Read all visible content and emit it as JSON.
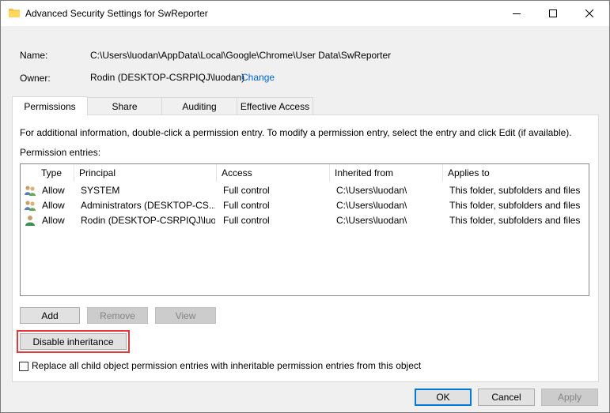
{
  "window": {
    "title": "Advanced Security Settings for SwReporter",
    "controls": [
      "minimize-icon",
      "maximize-icon",
      "close-icon"
    ]
  },
  "info": {
    "name_label": "Name:",
    "name_value": "C:\\Users\\luodan\\AppData\\Local\\Google\\Chrome\\User Data\\SwReporter",
    "owner_label": "Owner:",
    "owner_value": "Rodin (DESKTOP-CSRPIQJ\\luodan)",
    "change_link": "Change"
  },
  "tabs": [
    {
      "label": "Permissions",
      "active": true
    },
    {
      "label": "Share",
      "active": false
    },
    {
      "label": "Auditing",
      "active": false
    },
    {
      "label": "Effective Access",
      "active": false
    }
  ],
  "permissions": {
    "info_text": "For additional information, double-click a permission entry. To modify a permission entry, select the entry and click Edit (if available).",
    "entries_label": "Permission entries:",
    "columns": [
      "Type",
      "Principal",
      "Access",
      "Inherited from",
      "Applies to"
    ],
    "rows": [
      {
        "icon": "group-users-icon",
        "type": "Allow",
        "principal": "SYSTEM",
        "access": "Full control",
        "inherited": "C:\\Users\\luodan\\",
        "applies": "This folder, subfolders and files"
      },
      {
        "icon": "group-users-icon",
        "type": "Allow",
        "principal": "Administrators (DESKTOP-CS...",
        "access": "Full control",
        "inherited": "C:\\Users\\luodan\\",
        "applies": "This folder, subfolders and files"
      },
      {
        "icon": "user-icon",
        "type": "Allow",
        "principal": "Rodin (DESKTOP-CSRPIQJ\\luo...",
        "access": "Full control",
        "inherited": "C:\\Users\\luodan\\",
        "applies": "This folder, subfolders and files"
      }
    ],
    "buttons": {
      "add": "Add",
      "remove": "Remove",
      "view": "View"
    },
    "disable_inheritance": "Disable inheritance",
    "replace_checkbox_label": "Replace all child object permission entries with inheritable permission entries from this object",
    "replace_checked": false
  },
  "footer": {
    "ok": "OK",
    "cancel": "Cancel",
    "apply": "Apply"
  },
  "colors": {
    "link": "#0066cc",
    "highlight_box": "#e03a3a",
    "primary_border": "#0078d7"
  }
}
